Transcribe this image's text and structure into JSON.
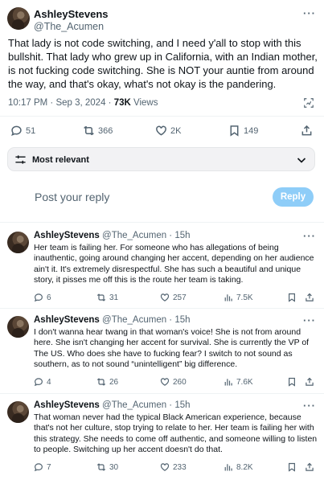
{
  "post": {
    "author_name": "AshleyStevens",
    "author_handle": "@The_Acumen",
    "more": "···",
    "text": "That lady is not code switching, and I need y'all to stop with this bullshit. That lady who grew up in California, with an Indian mother, is not fucking code switching. She is NOT your auntie from around the way, and that's okay, what's not okay is the pandering.",
    "timestamp": "10:17 PM · Sep 3, 2024 · ",
    "views_count": "73K",
    "views_label": " Views",
    "actions": {
      "replies": "51",
      "reposts": "366",
      "likes": "2K",
      "bookmarks": "149"
    }
  },
  "sort": {
    "label": "Most relevant"
  },
  "composer": {
    "placeholder": "Post your reply",
    "button": "Reply"
  },
  "replies": [
    {
      "name": "AshleyStevens",
      "handle": "@The_Acumen",
      "dot": " · ",
      "time": "15h",
      "text": "Her team is failing her. For someone who has allegations of being inauthentic, going around changing her accent, depending on her audience ain't it. It's extremely disrespectful. She has such a beautiful and unique story, it pisses me off this is the route her team is taking.",
      "replies": "6",
      "reposts": "31",
      "likes": "257",
      "views": "7.5K"
    },
    {
      "name": "AshleyStevens",
      "handle": "@The_Acumen",
      "dot": " · ",
      "time": "15h",
      "text": "I don't wanna hear twang in that woman's voice! She is not from around here. She isn't changing her accent for survival. She is currently the VP of The US. Who does she have to fucking fear? I switch to not sound as southern, as to not sound “unintelligent” big difference.",
      "replies": "4",
      "reposts": "26",
      "likes": "260",
      "views": "7.6K"
    },
    {
      "name": "AshleyStevens",
      "handle": "@The_Acumen",
      "dot": " · ",
      "time": "15h",
      "text": "That woman never had the typical Black American experience, because that's not her culture, stop trying to relate to her. Her team is failing her with this strategy. She needs to come off authentic, and someone willing to listen to people. Switching up her accent doesn't do that.",
      "replies": "7",
      "reposts": "30",
      "likes": "233",
      "views": "8.2K"
    }
  ],
  "colors": {
    "accent": "#1d9bf0",
    "reply_button": "#8ecdf8",
    "muted": "#536471"
  }
}
